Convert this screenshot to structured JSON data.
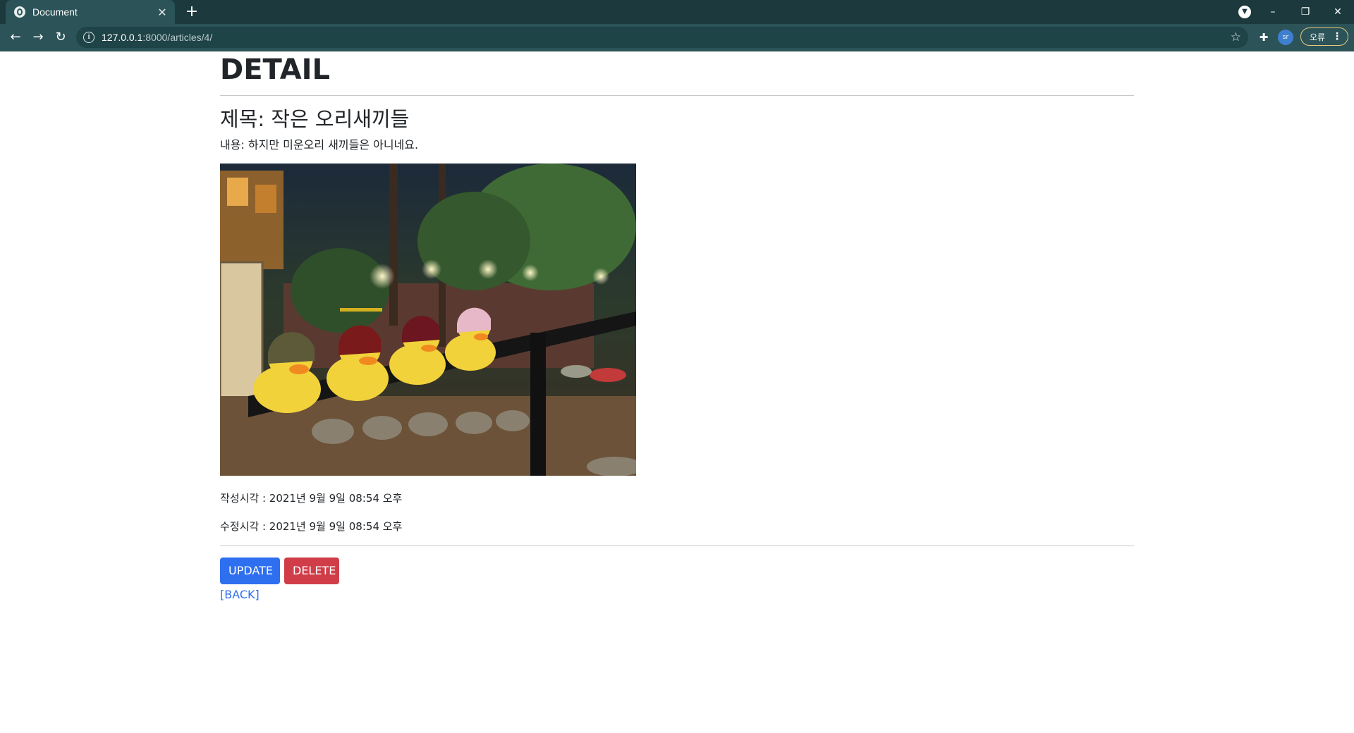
{
  "browser": {
    "tab_title": "Document",
    "tab_close": "✕",
    "new_tab": "+",
    "url_host": "127.0.0.1",
    "url_rest": ":8000/articles/4/",
    "profile_label": "sr",
    "error_label": "오류",
    "window_controls": {
      "minimize": "–",
      "restore": "❐",
      "close": "✕"
    },
    "nav": {
      "back": "←",
      "forward": "→",
      "reload": "↻"
    }
  },
  "page": {
    "heading": "DETAIL",
    "title_line": "제목: 작은 오리새끼들",
    "content_line": "내용: 하지만 미운오리 새끼들은 아니네요.",
    "created_line": "작성시각 : 2021년 9월 9일 08:54 오후",
    "updated_line": "수정시각 : 2021년 9월 9일 08:54 오후",
    "update_button": "UPDATE",
    "delete_button": "DELETE",
    "back_link": "[BACK]"
  },
  "colors": {
    "primary": "#2e6ff0",
    "danger": "#d03d49",
    "chrome_dark": "#1c3a3e",
    "chrome_toolbar": "#2b5358"
  }
}
